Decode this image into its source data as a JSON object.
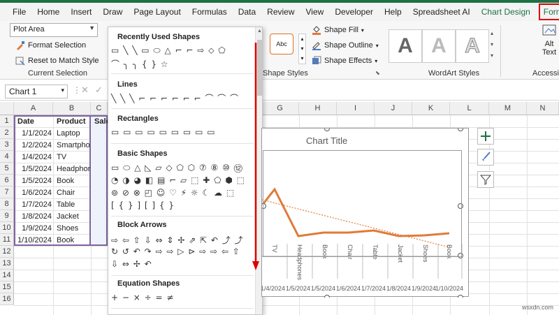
{
  "tabs": [
    "File",
    "Home",
    "Insert",
    "Draw",
    "Page Layout",
    "Formulas",
    "Data",
    "Review",
    "View",
    "Developer",
    "Help",
    "Spreadsheet AI",
    "Chart Design",
    "Format"
  ],
  "ribbon": {
    "selection_combo": "Plot Area",
    "format_selection": "Format Selection",
    "reset_style": "Reset to Match Style",
    "current_selection": "Current Selection",
    "abc_label": "Abc",
    "shape_fill": "Shape Fill",
    "shape_outline": "Shape Outline",
    "shape_effects": "Shape Effects",
    "shape_styles": "Shape Styles",
    "wordart_styles": "WordArt Styles",
    "wordart_letter": "A",
    "alt_text_1": "Alt",
    "alt_text_2": "Text",
    "accessibility": "Accessibi"
  },
  "formula_bar": {
    "name_box": "Chart 1"
  },
  "columns": [
    "A",
    "B",
    "C",
    "D",
    "E",
    "F",
    "G",
    "H",
    "I",
    "J",
    "K",
    "L",
    "M",
    "N"
  ],
  "rows": [
    "1",
    "2",
    "3",
    "4",
    "5",
    "6",
    "7",
    "8",
    "9",
    "10",
    "11",
    "12",
    "13",
    "14",
    "15",
    "16"
  ],
  "table": {
    "headers": [
      "Date",
      "Product",
      "Sale"
    ],
    "dates": [
      "1/1/2024",
      "1/2/2024",
      "1/4/2024",
      "1/5/2024",
      "1/5/2024",
      "1/6/2024",
      "1/7/2024",
      "1/8/2024",
      "1/9/2024",
      "1/10/2024"
    ],
    "products": [
      "Laptop",
      "Smartpho",
      "TV",
      "Headphor",
      "Book",
      "Chair",
      "Table",
      "Jacket",
      "Shoes",
      "Book"
    ]
  },
  "shape_panel": {
    "recently_used": "Recently Used Shapes",
    "lines": "Lines",
    "rectangles": "Rectangles",
    "basic_shapes": "Basic Shapes",
    "block_arrows": "Block Arrows",
    "equation_shapes": "Equation Shapes",
    "recent_glyphs_1": "▭ ╲ ╲ ▭ ⬭ △ ⌐ ⌐ ⇨ ⬦ ⬠",
    "recent_glyphs_2": "⌒ ╮ ╮ { } ☆",
    "line_glyphs": "╲ ╲ ╲ ⌐ ⌐ ⌐ ⌐ ⌐ ⌐ ⌒ ⌒ ⌒",
    "rect_glyphs": "▭ ▭ ▭ ▭ ▭ ▭ ▭ ▭ ▭",
    "basic_glyphs_1": "▭ ⬭ △ ◺ ▱ ◇ ⬠ ⬡ ⑦ ⑧ ⑩ ⑫",
    "basic_glyphs_2": "◔ ◑ ◕ ◧ ▤ ⌐ ▱ ⬚ ✚ ⬠ ⬢ ⬚",
    "basic_glyphs_3": "⊚ ⊘ ⊗ ◰ ☺ ♡ ⚡ ☼ ☾ ☁ ⬚",
    "basic_glyphs_4": "[ { } ] [ ] { }",
    "arrow_glyphs_1": "⇨ ⇦ ⇧ ⇩ ⇔ ⇕ ✢ ⇗ ⇱ ↶ ⤴ ⤴",
    "arrow_glyphs_2": "↻ ↺ ↶ ↷ ⇨ ⇨ ▷ ⊳ ⇨ ⇨ ⇦ ⇧",
    "arrow_glyphs_3": "⇩ ⇔ ✢ ↶",
    "eq_glyphs": "+ − × ÷ = ≠"
  },
  "chart": {
    "title": "Chart Title",
    "x_categories": [
      "TV",
      "Headphones",
      "Book",
      "Chair",
      "Table",
      "Jacket",
      "Shoes",
      "Book"
    ],
    "date_labels": [
      "1/4/2024",
      "1/5/2024",
      "1/5/2024",
      "1/6/2024",
      "1/7/2024",
      "1/8/2024",
      "1/9/2024",
      "1/10/2024"
    ],
    "line_color": "#e07a3a",
    "trend_color": "#e07a3a"
  },
  "watermark": "wsxdn.com"
}
